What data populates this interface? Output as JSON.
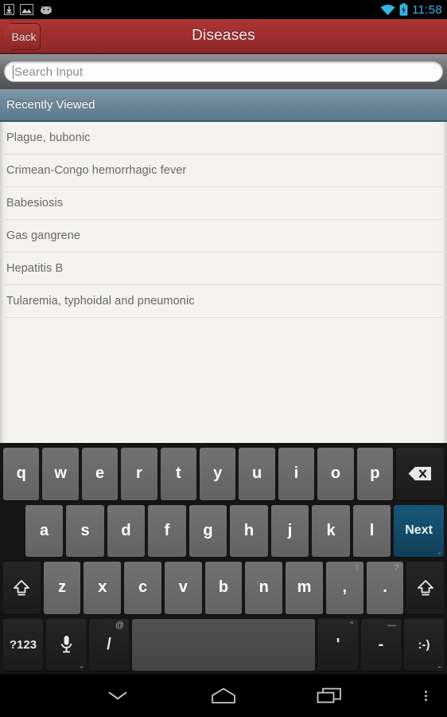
{
  "status_bar": {
    "left_icons": [
      "download-icon",
      "gallery-image-icon",
      "android-face-icon"
    ],
    "wifi_icon": "wifi-icon",
    "battery_icon": "battery-charging-icon",
    "clock": "11:58",
    "clock_color": "#33b5e5"
  },
  "title_bar": {
    "back_label": "Back",
    "title": "Diseases",
    "accent_color": "#a02f2f"
  },
  "search": {
    "placeholder": "Search Input",
    "value": ""
  },
  "list": {
    "section_header": "Recently Viewed",
    "section_color": "#6c8797",
    "items": [
      {
        "label": "Plague, bubonic"
      },
      {
        "label": "Crimean-Congo hemorrhagic fever"
      },
      {
        "label": "Babesiosis"
      },
      {
        "label": "Gas gangrene"
      },
      {
        "label": "Hepatitis B"
      },
      {
        "label": "Tularemia, typhoidal and pneumonic"
      }
    ]
  },
  "keyboard": {
    "row1": [
      {
        "label": "q"
      },
      {
        "label": "w"
      },
      {
        "label": "e"
      },
      {
        "label": "r"
      },
      {
        "label": "t"
      },
      {
        "label": "y"
      },
      {
        "label": "u"
      },
      {
        "label": "i"
      },
      {
        "label": "o"
      },
      {
        "label": "p"
      }
    ],
    "backspace": {
      "icon": "backspace-icon",
      "label": ""
    },
    "row2": [
      {
        "label": "a"
      },
      {
        "label": "s"
      },
      {
        "label": "d"
      },
      {
        "label": "f"
      },
      {
        "label": "g"
      },
      {
        "label": "h"
      },
      {
        "label": "j"
      },
      {
        "label": "k"
      },
      {
        "label": "l"
      }
    ],
    "action_key": {
      "label": "Next",
      "color": "#17577a",
      "hint": "..."
    },
    "row3": [
      {
        "label": "z"
      },
      {
        "label": "x"
      },
      {
        "label": "c"
      },
      {
        "label": "v"
      },
      {
        "label": "b"
      },
      {
        "label": "n"
      },
      {
        "label": "m"
      },
      {
        "label": ",",
        "sup": "!"
      },
      {
        "label": ".",
        "sup": "?"
      }
    ],
    "shift_left": {
      "icon": "shift-icon"
    },
    "shift_right": {
      "icon": "shift-icon"
    },
    "row4": {
      "symbols_key": {
        "label": "?123"
      },
      "mic_key": {
        "icon": "microphone-icon",
        "hint": "..."
      },
      "slash_key": {
        "label": "/",
        "sup": "@"
      },
      "space_key": {
        "label": ""
      },
      "apostrophe_key": {
        "label": "'",
        "sup": "\""
      },
      "hyphen_key": {
        "label": "-",
        "sup": "—"
      },
      "emoji_key": {
        "label": ":-)",
        "hint": "..."
      }
    }
  },
  "nav_bar": {
    "hide_keyboard": {
      "icon": "chevron-down-icon"
    },
    "home": {
      "icon": "home-icon"
    },
    "recents": {
      "icon": "recents-icon"
    },
    "menu": {
      "icon": "overflow-menu-icon"
    }
  }
}
